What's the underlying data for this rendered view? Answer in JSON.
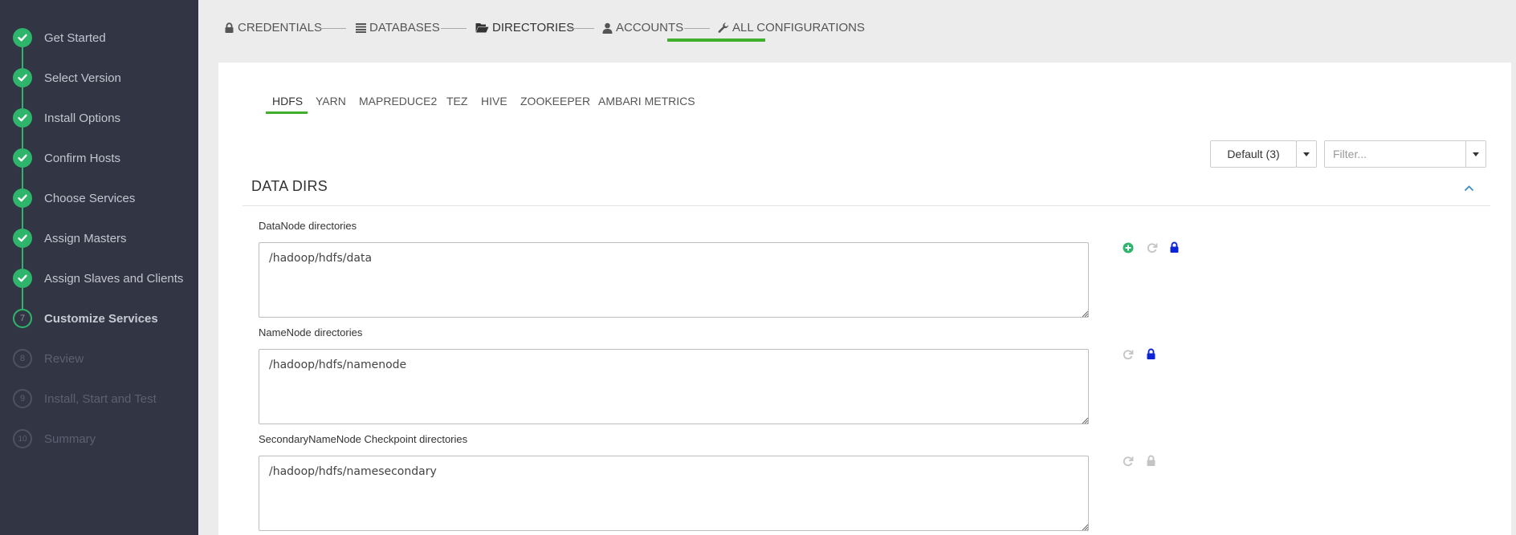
{
  "sidebar": {
    "steps": [
      {
        "label": "Get Started",
        "state": "done"
      },
      {
        "label": "Select Version",
        "state": "done"
      },
      {
        "label": "Install Options",
        "state": "done"
      },
      {
        "label": "Confirm Hosts",
        "state": "done"
      },
      {
        "label": "Choose Services",
        "state": "done"
      },
      {
        "label": "Assign Masters",
        "state": "done"
      },
      {
        "label": "Assign Slaves and Clients",
        "state": "done"
      },
      {
        "label": "Customize Services",
        "state": "current",
        "number": "7"
      },
      {
        "label": "Review",
        "state": "todo",
        "number": "8"
      },
      {
        "label": "Install, Start and Test",
        "state": "todo",
        "number": "9"
      },
      {
        "label": "Summary",
        "state": "todo",
        "number": "10"
      }
    ]
  },
  "topnav": {
    "items": [
      {
        "label": "CREDENTIALS",
        "icon": "lock-icon"
      },
      {
        "label": "DATABASES",
        "icon": "list-icon"
      },
      {
        "label": "DIRECTORIES",
        "icon": "folder-open-icon",
        "active": true
      },
      {
        "label": "ACCOUNTS",
        "icon": "user-icon"
      },
      {
        "label": "ALL CONFIGURATIONS",
        "icon": "wrench-icon"
      }
    ]
  },
  "subtabs": [
    "HDFS",
    "YARN",
    "MAPREDUCE2",
    "TEZ",
    "HIVE",
    "ZOOKEEPER",
    "AMBARI METRICS"
  ],
  "config_group": {
    "label": "Default (3)"
  },
  "filter": {
    "placeholder": "Filter..."
  },
  "section": {
    "title": "DATA DIRS",
    "fields": [
      {
        "label": "DataNode directories",
        "value": "/hadoop/hdfs/data",
        "actions": [
          "add-icon",
          "refresh-icon",
          "lock-icon"
        ]
      },
      {
        "label": "NameNode directories",
        "value": "/hadoop/hdfs/namenode",
        "actions": [
          "refresh-icon",
          "lock-icon"
        ]
      },
      {
        "label": "SecondaryNameNode Checkpoint directories",
        "value": "/hadoop/hdfs/namesecondary",
        "actions": [
          "refresh-icon",
          "lock-icon-disabled"
        ]
      }
    ]
  },
  "colors": {
    "accent_green": "#2fb56b",
    "tab_underline": "#3fae2a",
    "lock_blue": "#0a24d6",
    "sidebar_bg": "#323544"
  }
}
